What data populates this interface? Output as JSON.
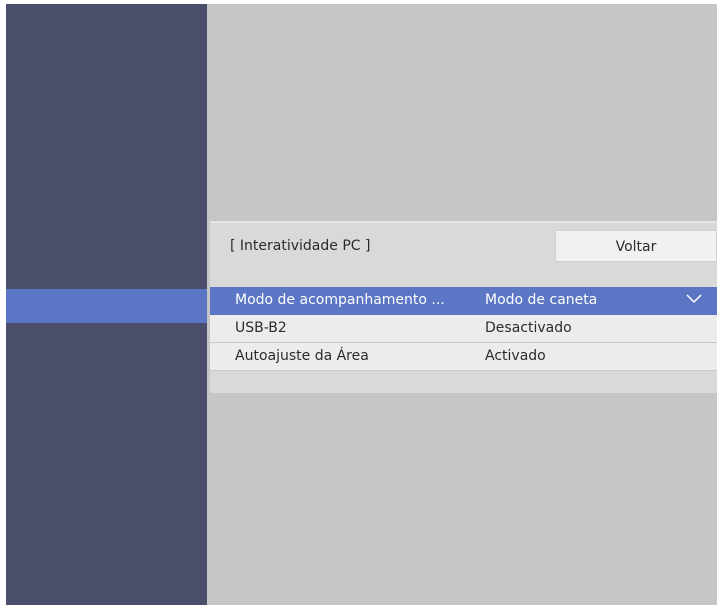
{
  "panel": {
    "title": "[ Interatividade PC ]",
    "back_label": "Voltar"
  },
  "rows": [
    {
      "label": "Modo de acompanhamento ...",
      "value": "Modo de caneta",
      "has_dropdown": true,
      "icon": "chevron-down-icon"
    },
    {
      "label": "USB-B2",
      "value": "Desactivado"
    },
    {
      "label": "Autoajuste da Área",
      "value": "Activado"
    }
  ],
  "colors": {
    "sidebar": "#4a4e6b",
    "highlight": "#5a76c4",
    "background": "#c6c6c6",
    "panel": "#d9d9d9"
  }
}
